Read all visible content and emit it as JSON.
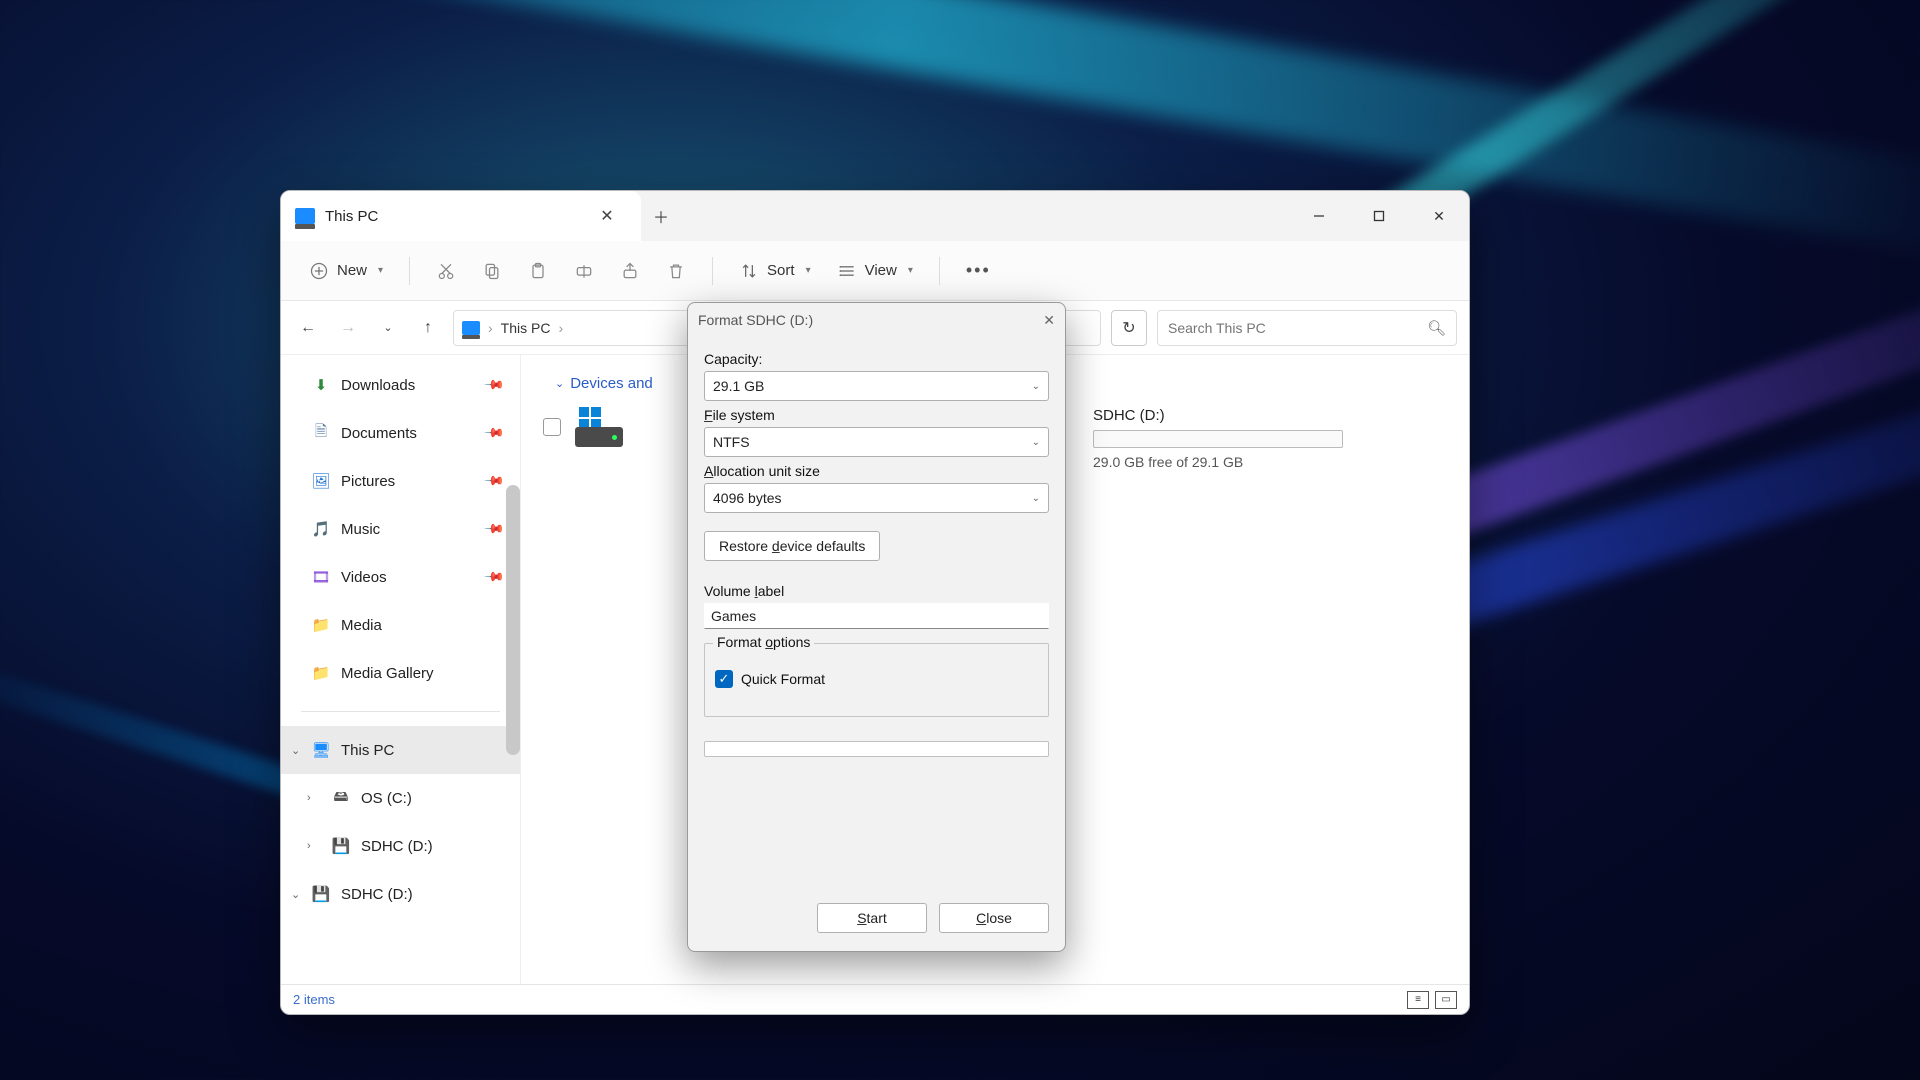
{
  "window": {
    "tab_title": "This PC",
    "toolbar": {
      "new": "New",
      "sort": "Sort",
      "view": "View"
    },
    "breadcrumb": {
      "root": "This PC"
    },
    "search_placeholder": "Search This PC",
    "sidebar": {
      "downloads": "Downloads",
      "documents": "Documents",
      "pictures": "Pictures",
      "music": "Music",
      "videos": "Videos",
      "media": "Media",
      "media_gallery": "Media Gallery",
      "this_pc": "This PC",
      "os_c": "OS (C:)",
      "sdhc_d_1": "SDHC (D:)",
      "sdhc_d_2": "SDHC (D:)"
    },
    "content": {
      "section": "Devices and",
      "drive2_title": "SDHC (D:)",
      "drive2_free": "29.0 GB free of 29.1 GB"
    },
    "footer": {
      "count": "2 items"
    }
  },
  "dialog": {
    "title": "Format SDHC (D:)",
    "capacity_label": "Capacity:",
    "capacity_value": "29.1 GB",
    "fs_label_prefix": "F",
    "fs_label_rest": "ile system",
    "fs_value": "NTFS",
    "au_label_prefix": "A",
    "au_label_rest": "llocation unit size",
    "au_value": "4096 bytes",
    "restore_prefix": "Restore ",
    "restore_u": "d",
    "restore_rest": "evice defaults",
    "vol_label_prefix": "Volume ",
    "vol_label_u": "l",
    "vol_label_rest": "abel",
    "vol_value": "Games",
    "fmt_opts_prefix": "Format ",
    "fmt_opts_u": "o",
    "fmt_opts_rest": "ptions",
    "quick_format": "Quick Format",
    "start_u": "S",
    "start_rest": "tart",
    "close_u": "C",
    "close_rest": "lose"
  }
}
